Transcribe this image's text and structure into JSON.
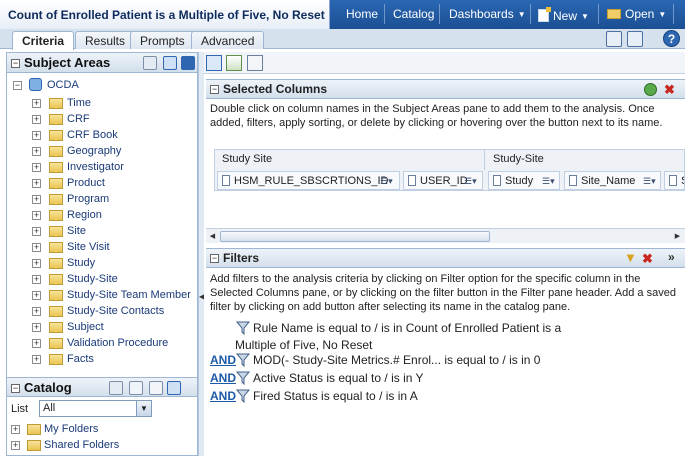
{
  "app": {
    "title": "Count of Enrolled Patient is a Multiple of Five, No Reset",
    "nav": {
      "home": "Home",
      "catalog": "Catalog",
      "dashboards": "Dashboards",
      "new": "New",
      "open": "Open"
    }
  },
  "tabs": [
    "Criteria",
    "Results",
    "Prompts",
    "Advanced"
  ],
  "subject_areas": {
    "header": "Subject Areas",
    "root": "OCDA",
    "items": [
      "Time",
      "CRF",
      "CRF Book",
      "Geography",
      "Investigator",
      "Product",
      "Program",
      "Region",
      "Site",
      "Site Visit",
      "Study",
      "Study-Site",
      "Study-Site Team Member",
      "Study-Site Contacts",
      "Subject",
      "Validation Procedure",
      "Facts"
    ]
  },
  "catalog": {
    "header": "Catalog",
    "list_label": "List",
    "list_value": "All",
    "folders": [
      "My Folders",
      "Shared Folders"
    ]
  },
  "selected_columns": {
    "header": "Selected Columns",
    "description": "Double click on column names in the Subject Areas pane to add them to the analysis. Once added, filters, apply sorting, or delete by clicking or hovering over the button next to its name.",
    "groups": [
      "Study Site",
      "Study-Site"
    ],
    "columns": [
      "HSM_RULE_SBSCRTIONS_ID",
      "USER_ID",
      "Study",
      "Site_Name",
      "St"
    ]
  },
  "filters": {
    "header": "Filters",
    "description": "Add filters to the analysis criteria by clicking on Filter option for the specific column in the Selected Columns pane, or by clicking on the filter button in the Filter pane header. Add a saved filter by clicking on add button after selecting its name in the catalog pane.",
    "and_label": "AND",
    "rows": [
      {
        "line1": "Rule Name is equal to / is in  Count of Enrolled Patient is a",
        "line2": "Multiple of Five, No Reset"
      },
      {
        "text": "MOD(- Study-Site Metrics.# Enrol... is equal to / is in  0"
      },
      {
        "text": "Active Status is equal to / is in  Y"
      },
      {
        "text": "Fired Status is equal to / is in  A"
      }
    ]
  },
  "colors": {
    "brand_blue": "#1b4f93",
    "link_blue": "#1d5aa8",
    "pane_border": "#9fb6d3"
  }
}
